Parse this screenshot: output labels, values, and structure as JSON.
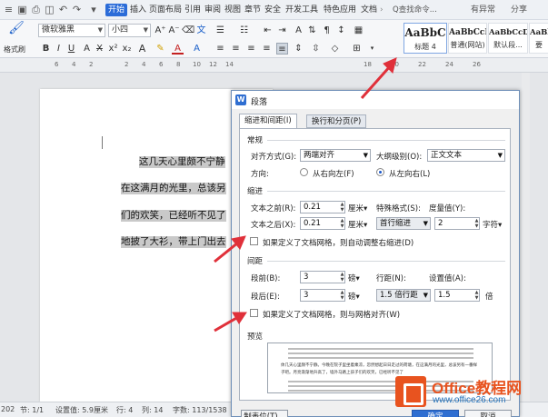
{
  "menubar": {
    "items": [
      "开始",
      "插入",
      "页面布局",
      "引用",
      "审阅",
      "视图",
      "章节",
      "安全",
      "开发工具",
      "特色应用",
      "文档"
    ],
    "active": "开始",
    "search_placeholder": "Q查找命令...",
    "right": [
      "有异常",
      "分享"
    ]
  },
  "ribbon": {
    "format_painter": "格式刷",
    "font_name": "微软雅黑",
    "font_size": "小四",
    "styles": [
      {
        "preview": "AaBbC",
        "name": "标题 4"
      },
      {
        "preview": "AaBbCcD",
        "name": "普通(网站)"
      },
      {
        "preview": "AaBbCcDd",
        "name": "默认段..."
      },
      {
        "preview": "AaBbCcDd",
        "name": "要"
      }
    ]
  },
  "ruler": {
    "numbers": [
      "6",
      "4",
      "2",
      "2",
      "4",
      "6",
      "8",
      "10",
      "12",
      "14",
      "16",
      "18",
      "20",
      "22",
      "24",
      "26"
    ]
  },
  "document": {
    "lines": [
      "这几天心里颇不宁静",
      "在这满月的光里，总该另",
      "们的欢笑，已经听不见了",
      "地披了大衫，带上门出去"
    ]
  },
  "dialog": {
    "title": "段落",
    "tabs": [
      "缩进和间距(I)",
      "换行和分页(P)"
    ],
    "general": {
      "section": "常规",
      "align_label": "对齐方式(G):",
      "align_value": "两端对齐",
      "outline_label": "大纲级别(O):",
      "outline_value": "正文文本",
      "direction_label": "方向:",
      "rtl_label": "从右向左(F)",
      "ltr_label": "从左向右(L)"
    },
    "indent": {
      "section": "缩进",
      "before_label": "文本之前(R):",
      "before_value": "0.21",
      "before_unit": "厘米▾",
      "after_label": "文本之后(X):",
      "after_value": "0.21",
      "after_unit": "厘米▾",
      "special_label": "特殊格式(S):",
      "special_value": "首行缩进",
      "measure_label": "度量值(Y):",
      "measure_value": "2",
      "measure_unit": "字符▾",
      "grid_check": "如果定义了文档网格，则自动调整右缩进(D)"
    },
    "spacing": {
      "section": "间距",
      "before_label": "段前(B):",
      "before_value": "3",
      "before_unit": "磅▾",
      "after_label": "段后(E):",
      "after_value": "3",
      "after_unit": "磅▾",
      "line_label": "行距(N):",
      "line_value": "1.5 倍行距",
      "setting_label": "设置值(A):",
      "setting_value": "1.5",
      "setting_unit": "倍",
      "grid_check": "如果定义了文档网格，则与网格对齐(W)"
    },
    "preview": {
      "section": "预览",
      "sample_text": "体几天心里颇不宁静。今晚在院子里坐着乘凉，忽然想起日日走过的荷塘，在这满月的光里，总该另有一番样子吧。月亮渐渐地升高了，墙外马路上孩子们的欢笑，已经听不见了"
    },
    "buttons": {
      "tabs": "制表位(T)...",
      "ok": "确定",
      "cancel": "取消"
    }
  },
  "statusbar": {
    "page_num": "202",
    "section": "节: 1/1",
    "position": "设置值: 5.9厘米",
    "row": "行: 4",
    "col": "列: 14",
    "words": "字数: 113/1538"
  },
  "watermark": {
    "name": "Office教程网",
    "url": "www.office26.com"
  },
  "colors": {
    "accent": "#2b6cd8",
    "arrow": "#e0303a",
    "brand": "#e8531f"
  }
}
